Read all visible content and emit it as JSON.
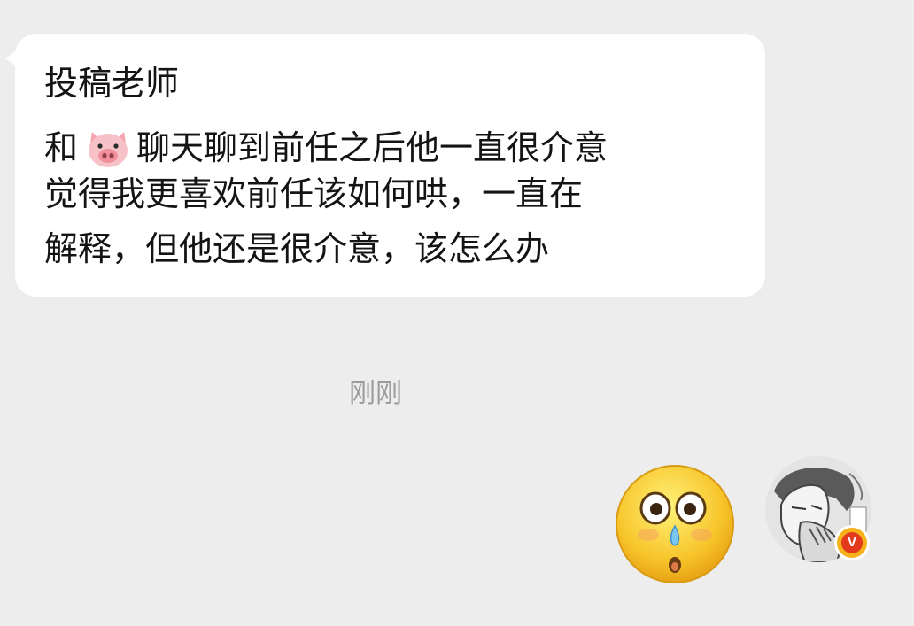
{
  "message": {
    "line1": "投稿老师",
    "line2_before_emoji": "和",
    "emoji": "pig-face-icon",
    "line2_after_emoji": "聊天聊到前任之后他一直很介意",
    "line3": "觉得我更喜欢前任该如何哄，一直在",
    "line4": "解释，但他还是很介意，该怎么办"
  },
  "timestamp": "刚刚",
  "reply": {
    "sticker": "shocked-face-sticker",
    "avatar": "user-avatar",
    "badge_letter": "V"
  },
  "colors": {
    "background": "#ededed",
    "bubble": "#ffffff",
    "text": "#141414",
    "timestamp": "#9b9b9b",
    "badge_outer": "#f6b21b",
    "badge_inner": "#e2391f"
  }
}
